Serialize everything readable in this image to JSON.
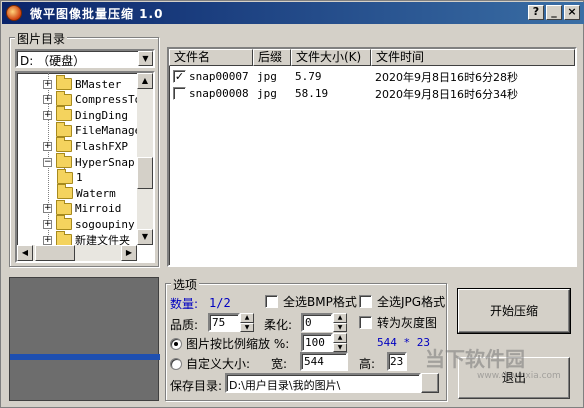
{
  "title": "微平图像批量压缩 1.0",
  "titlebar_buttons": {
    "help": "?",
    "minimize": "_",
    "close": "×"
  },
  "left_panel": {
    "group_label": "图片目录",
    "drive": "D: （硬盘）",
    "tree": [
      {
        "label": "BMaster",
        "expandable": true
      },
      {
        "label": "CompressTo",
        "expandable": true
      },
      {
        "label": "DingDing",
        "expandable": true
      },
      {
        "label": "FileManage",
        "expandable": false
      },
      {
        "label": "FlashFXP",
        "expandable": true
      },
      {
        "label": "HyperSnap",
        "expandable": true,
        "expanded": true
      },
      {
        "label": "1",
        "expandable": false,
        "child": true
      },
      {
        "label": "Waterm",
        "expandable": false,
        "child": true
      },
      {
        "label": "Mirroid",
        "expandable": true
      },
      {
        "label": "sogoupiny",
        "expandable": true
      },
      {
        "label": "新建文件夹",
        "expandable": true
      }
    ]
  },
  "file_list": {
    "columns": [
      "文件名",
      "后缀",
      "文件大小(K)",
      "文件时间"
    ],
    "rows": [
      {
        "checked": true,
        "name": "snap00007",
        "ext": "jpg",
        "size": "5.79",
        "time": "2020年9月8日16时6分28秒"
      },
      {
        "checked": false,
        "name": "snap00008",
        "ext": "jpg",
        "size": "58.19",
        "time": "2020年9月8日16时6分34秒"
      }
    ]
  },
  "options": {
    "group_label": "选项",
    "count_label": "数量:",
    "count_value": "1/2",
    "select_all_bmp": "全选BMP格式",
    "select_all_jpg": "全选JPG格式",
    "quality_label": "品质:",
    "quality_value": "75",
    "soften_label": "柔化:",
    "soften_value": "0",
    "grayscale_label": "转为灰度图",
    "scale_label": "图片按比例缩放 %:",
    "scale_value": "100",
    "dimensions_readout": "544 * 23",
    "custom_size_label": "自定义大小:",
    "width_label": "宽:",
    "width_value": "544",
    "height_label": "高:",
    "height_value": "23",
    "save_dir_label": "保存目录:",
    "save_dir_value": "D:\\用户目录\\我的图片\\"
  },
  "buttons": {
    "start": "开始压缩",
    "exit": "退出"
  },
  "watermark": {
    "text": "当下软件园",
    "url": "www.downxia.com"
  }
}
